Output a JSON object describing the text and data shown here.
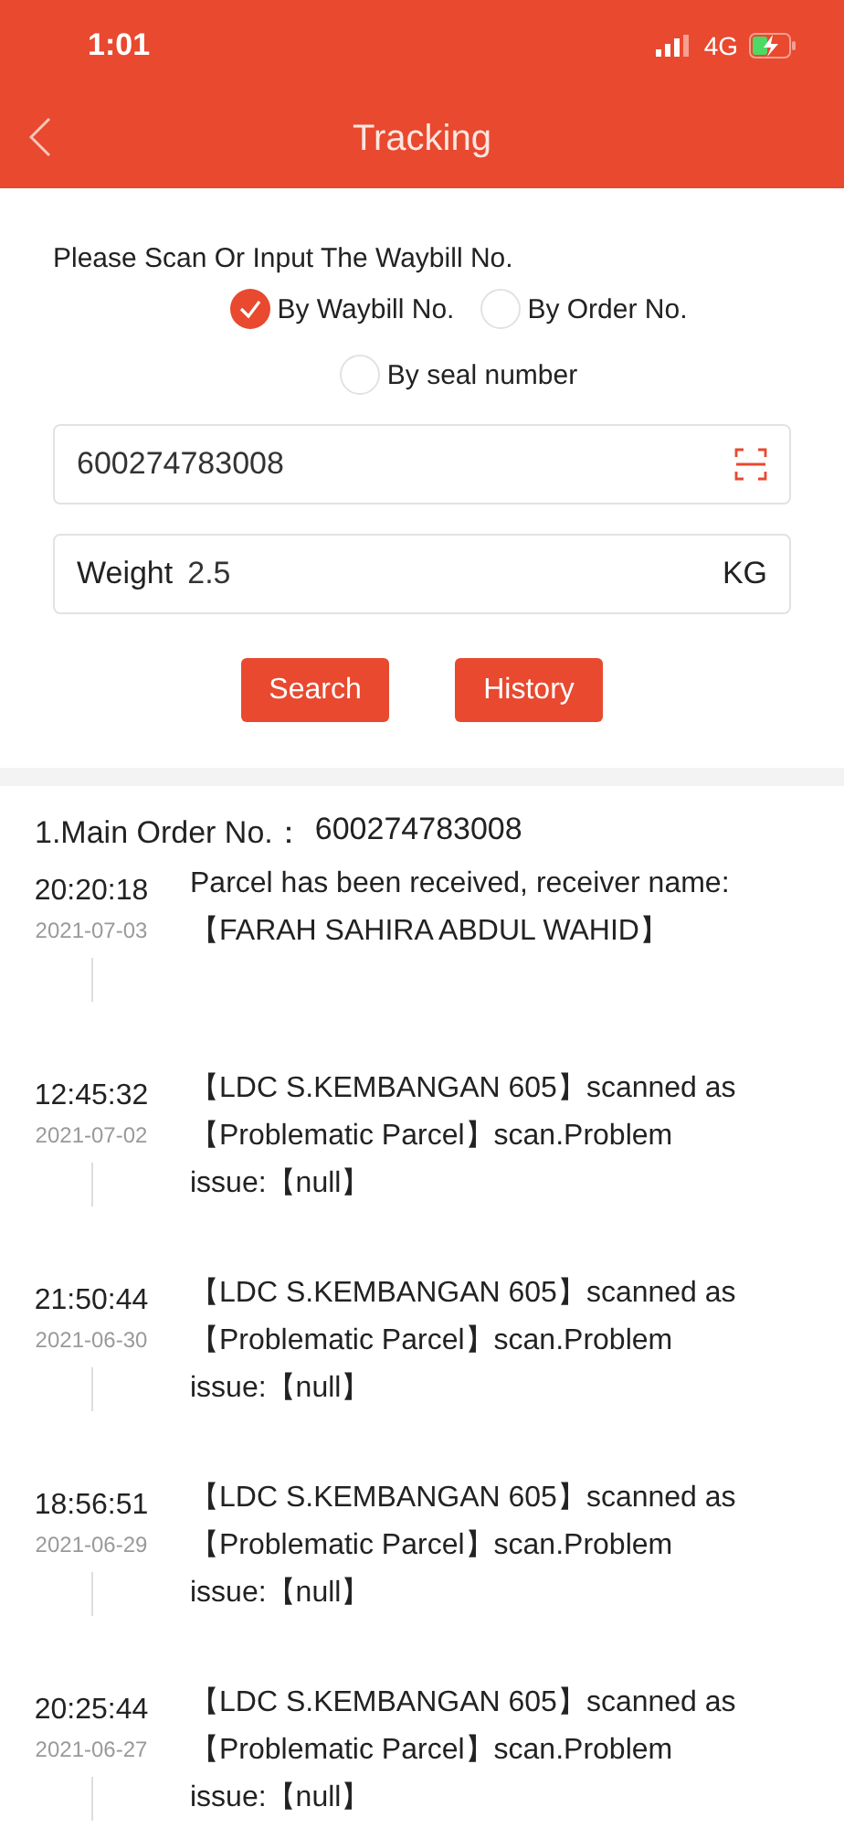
{
  "status_bar": {
    "time": "1:01",
    "network": "4G"
  },
  "nav": {
    "title": "Tracking"
  },
  "form": {
    "prompt": "Please Scan Or Input The Waybill No.",
    "options": [
      {
        "label": "By Waybill No.",
        "selected": true
      },
      {
        "label": "By Order No.",
        "selected": false
      },
      {
        "label": "By seal number",
        "selected": false
      }
    ],
    "waybill": {
      "value": "600274783008"
    },
    "weight": {
      "label": "Weight",
      "value": "2.5",
      "unit": "KG"
    },
    "buttons": [
      "Search",
      "History"
    ]
  },
  "results": {
    "order_label": "1.Main Order No.：",
    "order_no": "600274783008",
    "events": [
      {
        "time": "20:20:18",
        "date": "2021-07-03",
        "text": "Parcel has been received, receiver name:\n【FARAH SAHIRA ABDUL WAHID】"
      },
      {
        "time": "12:45:32",
        "date": "2021-07-02",
        "text": "【LDC S.KEMBANGAN 605】scanned as\n【Problematic Parcel】scan.Problem\nissue:【null】"
      },
      {
        "time": "21:50:44",
        "date": "2021-06-30",
        "text": "【LDC S.KEMBANGAN 605】scanned as\n【Problematic Parcel】scan.Problem\nissue:【null】"
      },
      {
        "time": "18:56:51",
        "date": "2021-06-29",
        "text": "【LDC S.KEMBANGAN 605】scanned as\n【Problematic Parcel】scan.Problem\nissue:【null】"
      },
      {
        "time": "20:25:44",
        "date": "2021-06-27",
        "text": "【LDC S.KEMBANGAN 605】scanned as\n【Problematic Parcel】scan.Problem\nissue:【null】"
      }
    ]
  }
}
